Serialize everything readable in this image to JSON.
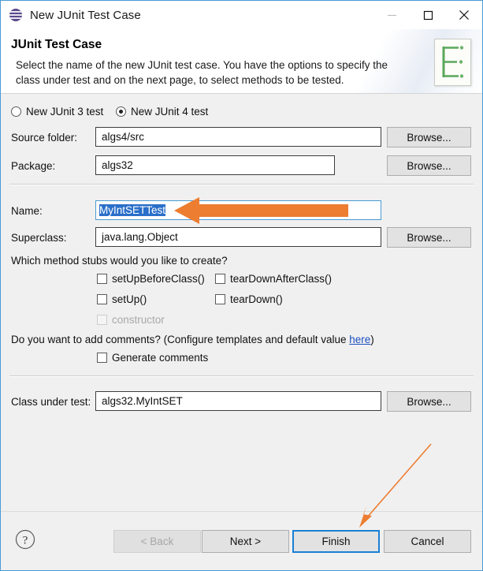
{
  "window": {
    "title": "New JUnit Test Case",
    "icon": "junit-sphere-icon",
    "minimize_glyph": "–",
    "maximize_glyph": "□",
    "close_glyph": "✕"
  },
  "banner": {
    "title": "JUnit Test Case",
    "description": "Select the name of the new JUnit test case. You have the options to specify the class under test and on the next page, to select methods to be tested.",
    "icon": "junit-wizard-page-icon"
  },
  "test_version": {
    "option_junit3": "New JUnit 3 test",
    "option_junit4": "New JUnit 4 test",
    "selected": "New JUnit 4 test"
  },
  "fields": {
    "source_folder": {
      "label": "Source folder:",
      "value": "algs4/src",
      "browse": "Browse..."
    },
    "package": {
      "label": "Package:",
      "value": "algs32",
      "browse": "Browse..."
    },
    "name": {
      "label": "Name:",
      "value": "MyIntSETTest",
      "selected": true
    },
    "superclass": {
      "label": "Superclass:",
      "value": "java.lang.Object",
      "browse": "Browse..."
    },
    "class_under_test": {
      "label": "Class under test:",
      "value": "algs32.MyIntSET",
      "browse": "Browse..."
    }
  },
  "method_stubs": {
    "prompt": "Which method stubs would you like to create?",
    "items": [
      {
        "label": "setUpBeforeClass()",
        "checked": false,
        "enabled": true
      },
      {
        "label": "tearDownAfterClass()",
        "checked": false,
        "enabled": true
      },
      {
        "label": "setUp()",
        "checked": false,
        "enabled": true
      },
      {
        "label": "tearDown()",
        "checked": false,
        "enabled": true
      },
      {
        "label": "constructor",
        "checked": false,
        "enabled": false
      }
    ]
  },
  "comments": {
    "prompt_before": "Do you want to add comments? (Configure templates and default value ",
    "link": "here",
    "prompt_after": ")",
    "checkbox_label": "Generate comments",
    "checked": false
  },
  "buttons": {
    "back": "< Back",
    "next": "Next >",
    "finish": "Finish",
    "cancel": "Cancel",
    "back_enabled": false,
    "finish_default": true,
    "help": "?"
  },
  "annotations": {
    "name_arrow": "orange-left-arrow-pointing-to-name-field",
    "finish_arrow": "orange-diagonal-arrow-pointing-to-finish-button",
    "color": "#ED7D31"
  }
}
